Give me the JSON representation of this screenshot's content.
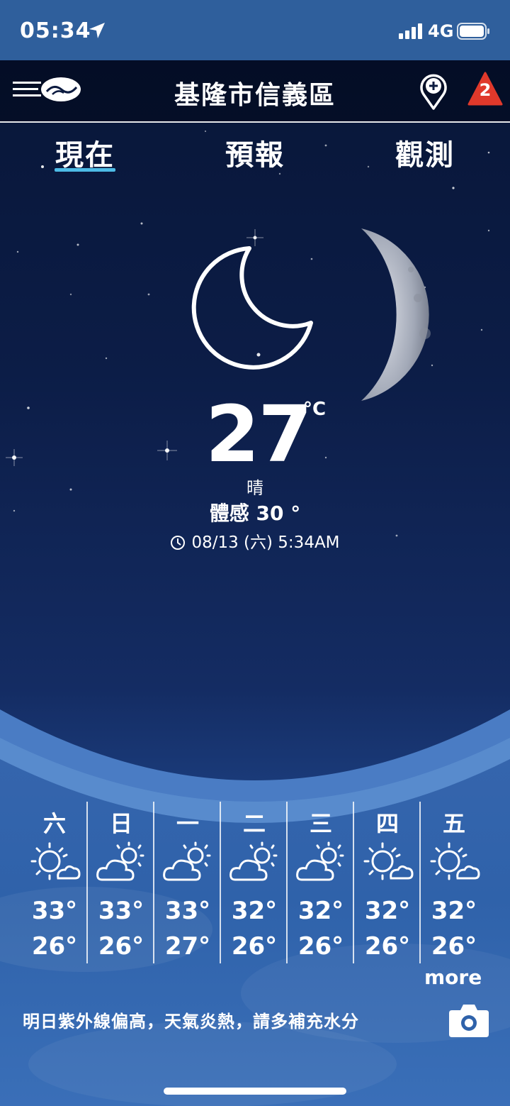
{
  "status_bar": {
    "time": "05:34",
    "network": "4G"
  },
  "header": {
    "location": "基隆市信義區",
    "alert_count": "2"
  },
  "tabs": [
    {
      "label": "現在",
      "active": true
    },
    {
      "label": "預報",
      "active": false
    },
    {
      "label": "觀測",
      "active": false
    }
  ],
  "current": {
    "temperature": "27",
    "unit": "°C",
    "condition": "晴",
    "feels_like": "體感 30 °",
    "updated": "08/13 (六) 5:34AM"
  },
  "week": [
    {
      "day": "六",
      "icon": "sun-cloud-icon",
      "high": "33°",
      "low": "26°"
    },
    {
      "day": "日",
      "icon": "cloud-sun-icon",
      "high": "33°",
      "low": "26°"
    },
    {
      "day": "一",
      "icon": "cloud-sun-icon",
      "high": "33°",
      "low": "27°"
    },
    {
      "day": "二",
      "icon": "cloud-sun-icon",
      "high": "32°",
      "low": "26°"
    },
    {
      "day": "三",
      "icon": "cloud-sun-icon",
      "high": "32°",
      "low": "26°"
    },
    {
      "day": "四",
      "icon": "sun-cloud-icon",
      "high": "32°",
      "low": "26°"
    },
    {
      "day": "五",
      "icon": "sun-cloud-icon",
      "high": "32°",
      "low": "26°"
    }
  ],
  "more_label": "more",
  "advisory": "明日紫外線偏高，天氣炎熱，請多補充水分",
  "colors": {
    "status_bar": "#2f5f9c",
    "tab_underline": "#4dbbe6",
    "alert": "#e0392b"
  }
}
